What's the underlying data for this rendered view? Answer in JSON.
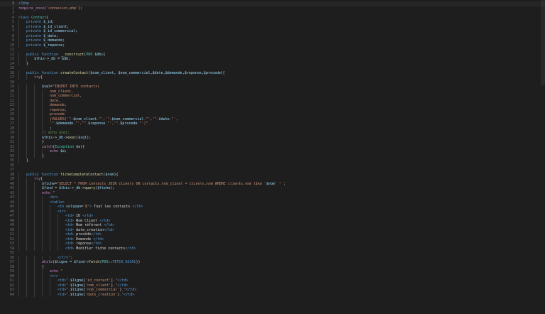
{
  "editor": {
    "active_line": 1,
    "lines": [
      {
        "n": "1",
        "i": 0,
        "t": [
          [
            "t-pre",
            "<?php"
          ]
        ]
      },
      {
        "n": "2",
        "i": 0,
        "t": [
          [
            "t-ctl",
            "require_once"
          ],
          [
            "t-pun",
            "("
          ],
          [
            "t-str",
            "'connexion.php'"
          ],
          [
            "t-pun",
            ");"
          ]
        ]
      },
      {
        "n": "3",
        "i": 0,
        "t": []
      },
      {
        "n": "4",
        "i": 0,
        "t": [
          [
            "t-kw",
            "class "
          ],
          [
            "t-cls",
            "Contact"
          ],
          [
            "t-pun",
            "{"
          ]
        ]
      },
      {
        "n": "5",
        "i": 1,
        "t": [
          [
            "t-kw",
            "private "
          ],
          [
            "t-var",
            "$_id"
          ],
          [
            "t-pun",
            ";"
          ]
        ]
      },
      {
        "n": "6",
        "i": 1,
        "t": [
          [
            "t-kw",
            "private "
          ],
          [
            "t-var",
            "$_id_client"
          ],
          [
            "t-pun",
            ";"
          ]
        ]
      },
      {
        "n": "7",
        "i": 1,
        "t": [
          [
            "t-kw",
            "private "
          ],
          [
            "t-var",
            "$_id_commercial"
          ],
          [
            "t-pun",
            ";"
          ]
        ]
      },
      {
        "n": "8",
        "i": 1,
        "t": [
          [
            "t-kw",
            "private "
          ],
          [
            "t-var",
            "$_date"
          ],
          [
            "t-pun",
            ";"
          ]
        ]
      },
      {
        "n": "9",
        "i": 1,
        "t": [
          [
            "t-kw",
            "private "
          ],
          [
            "t-var",
            "$_demande"
          ],
          [
            "t-pun",
            ";"
          ]
        ]
      },
      {
        "n": "10",
        "i": 1,
        "t": [
          [
            "t-kw",
            "private "
          ],
          [
            "t-var",
            "$_reponse"
          ],
          [
            "t-pun",
            ";"
          ]
        ]
      },
      {
        "n": "11",
        "i": 0,
        "t": []
      },
      {
        "n": "12",
        "i": 1,
        "t": [
          [
            "t-kw",
            "public function "
          ],
          [
            "t-fn",
            "__construct"
          ],
          [
            "t-pun",
            "("
          ],
          [
            "t-cls",
            "PDO "
          ],
          [
            "t-var",
            "$db"
          ],
          [
            "t-pun",
            "){"
          ]
        ]
      },
      {
        "n": "13",
        "i": 2,
        "t": [
          [
            "t-var",
            "$this"
          ],
          [
            "t-pun",
            "->"
          ],
          [
            "t-var",
            "_db"
          ],
          [
            "t-pun",
            " = "
          ],
          [
            "t-var",
            "$db"
          ],
          [
            "t-pun",
            ";"
          ]
        ]
      },
      {
        "n": "14",
        "i": 1,
        "t": [
          [
            "t-pun",
            "}"
          ]
        ]
      },
      {
        "n": "15",
        "i": 0,
        "t": []
      },
      {
        "n": "16",
        "i": 1,
        "t": [
          [
            "t-kw",
            "public function "
          ],
          [
            "t-fn",
            "createContact"
          ],
          [
            "t-pun",
            "("
          ],
          [
            "t-var",
            "$nom_client"
          ],
          [
            "t-pun",
            ", "
          ],
          [
            "t-var",
            "$nom_commercial"
          ],
          [
            "t-pun",
            ","
          ],
          [
            "t-var",
            "$date"
          ],
          [
            "t-pun",
            ","
          ],
          [
            "t-var",
            "$demande"
          ],
          [
            "t-pun",
            ","
          ],
          [
            "t-var",
            "$reponse"
          ],
          [
            "t-pun",
            ","
          ],
          [
            "t-var",
            "$procede"
          ],
          [
            "t-pun",
            "){"
          ]
        ]
      },
      {
        "n": "17",
        "i": 2,
        "t": [
          [
            "t-ctl",
            "try"
          ],
          [
            "t-pun",
            "{"
          ]
        ]
      },
      {
        "n": "18",
        "i": 0,
        "t": []
      },
      {
        "n": "19",
        "i": 3,
        "t": [
          [
            "t-var",
            "$sql"
          ],
          [
            "t-pun",
            "="
          ],
          [
            "t-str",
            "\"INSERT INTO contacts("
          ]
        ]
      },
      {
        "n": "20",
        "i": 4,
        "t": [
          [
            "t-str",
            "nom_client,"
          ]
        ]
      },
      {
        "n": "21",
        "i": 4,
        "t": [
          [
            "t-str",
            "nom_commercial,"
          ]
        ]
      },
      {
        "n": "22",
        "i": 4,
        "t": [
          [
            "t-str",
            "date,"
          ]
        ]
      },
      {
        "n": "23",
        "i": 4,
        "t": [
          [
            "t-str",
            "demande,"
          ]
        ]
      },
      {
        "n": "24",
        "i": 4,
        "t": [
          [
            "t-str",
            "reponse,"
          ]
        ]
      },
      {
        "n": "25",
        "i": 4,
        "t": [
          [
            "t-str",
            "procede"
          ]
        ]
      },
      {
        "n": "26",
        "i": 4,
        "t": [
          [
            "t-str",
            ")VALUES('\"."
          ],
          [
            "t-var",
            "$nom_client"
          ],
          [
            "t-str",
            ".\"','\"."
          ],
          [
            "t-var",
            "$nom_commercial"
          ],
          [
            "t-str",
            ".\"','\"."
          ],
          [
            "t-var",
            "$date"
          ],
          [
            "t-str",
            ".\"',"
          ]
        ]
      },
      {
        "n": "27",
        "i": 4,
        "t": [
          [
            "t-str",
            "'\"."
          ],
          [
            "t-var",
            "$demande"
          ],
          [
            "t-str",
            ".\"','\"."
          ],
          [
            "t-var",
            "$reponse"
          ],
          [
            "t-str",
            ".\"','\"."
          ],
          [
            "t-var",
            "$procede"
          ],
          [
            "t-str",
            ".\"')\""
          ]
        ]
      },
      {
        "n": "28",
        "i": 4,
        "t": [
          [
            "t-pun",
            ";"
          ]
        ]
      },
      {
        "n": "29",
        "i": 3,
        "t": [
          [
            "t-cmt",
            "// echo $sql;"
          ]
        ]
      },
      {
        "n": "30",
        "i": 3,
        "t": [
          [
            "t-var",
            "$this"
          ],
          [
            "t-pun",
            "->"
          ],
          [
            "t-var",
            "_db"
          ],
          [
            "t-pun",
            "->"
          ],
          [
            "t-fn",
            "exec"
          ],
          [
            "t-pun",
            "("
          ],
          [
            "t-var",
            "$sql"
          ],
          [
            "t-pun",
            ");"
          ]
        ]
      },
      {
        "n": "31",
        "i": 3,
        "t": [
          [
            "t-pun",
            "}"
          ]
        ]
      },
      {
        "n": "32",
        "i": 3,
        "t": [
          [
            "t-ctl",
            "catch"
          ],
          [
            "t-pun",
            "("
          ],
          [
            "t-cls",
            "Exception "
          ],
          [
            "t-var",
            "$e"
          ],
          [
            "t-pun",
            "){"
          ]
        ]
      },
      {
        "n": "33",
        "i": 4,
        "t": [
          [
            "t-ctl",
            "echo "
          ],
          [
            "t-var",
            "$e"
          ],
          [
            "t-pun",
            ";"
          ]
        ]
      },
      {
        "n": "34",
        "i": 3,
        "t": [
          [
            "t-pun",
            "}"
          ]
        ]
      },
      {
        "n": "35",
        "i": 1,
        "t": [
          [
            "t-pun",
            "}"
          ]
        ]
      },
      {
        "n": "36",
        "i": 0,
        "t": []
      },
      {
        "n": "37",
        "i": 0,
        "t": []
      },
      {
        "n": "38",
        "i": 1,
        "t": [
          [
            "t-kw",
            "public function "
          ],
          [
            "t-fn",
            "ficheCompleteContact"
          ],
          [
            "t-pun",
            "("
          ],
          [
            "t-var",
            "$nom"
          ],
          [
            "t-pun",
            "){"
          ]
        ]
      },
      {
        "n": "39",
        "i": 2,
        "t": [
          [
            "t-ctl",
            "try"
          ],
          [
            "t-pun",
            "{"
          ]
        ]
      },
      {
        "n": "40",
        "i": 3,
        "t": [
          [
            "t-var",
            "$fiche"
          ],
          [
            "t-pun",
            "="
          ],
          [
            "t-str",
            "\"SELECT * FROM contacts JOIN clients ON contacts.nom_client = clients.nom WHERE clients.nom like '"
          ],
          [
            "t-var",
            "$nom"
          ],
          [
            "t-str",
            "' \""
          ],
          [
            "t-pun",
            " ;"
          ]
        ]
      },
      {
        "n": "41",
        "i": 3,
        "t": [
          [
            "t-var",
            "$find"
          ],
          [
            "t-pun",
            " = "
          ],
          [
            "t-var",
            "$this"
          ],
          [
            "t-pun",
            "->"
          ],
          [
            "t-var",
            "_db"
          ],
          [
            "t-pun",
            "->"
          ],
          [
            "t-fn",
            "query"
          ],
          [
            "t-pun",
            "("
          ],
          [
            "t-var",
            "$fiche"
          ],
          [
            "t-pun",
            ");"
          ]
        ]
      },
      {
        "n": "42",
        "i": 3,
        "t": [
          [
            "t-ctl",
            "echo "
          ],
          [
            "t-str",
            "\""
          ]
        ]
      },
      {
        "n": "43",
        "i": 4,
        "t": [
          [
            "t-tag",
            "<br>"
          ]
        ]
      },
      {
        "n": "44",
        "i": 4,
        "t": [
          [
            "t-tag",
            "<table>"
          ]
        ]
      },
      {
        "n": "45",
        "i": 5,
        "t": [
          [
            "t-tag",
            "<th "
          ],
          [
            "t-attr",
            "colspan"
          ],
          [
            "t-pun",
            "="
          ],
          [
            "t-str",
            "'8'"
          ],
          [
            "t-tag",
            "> "
          ],
          [
            "t-txt",
            "Tout les contacts "
          ],
          [
            "t-tag",
            "</th>"
          ]
        ]
      },
      {
        "n": "46",
        "i": 5,
        "t": [
          [
            "t-tag",
            "<tr>"
          ]
        ]
      },
      {
        "n": "47",
        "i": 6,
        "t": [
          [
            "t-tag",
            "<td> "
          ],
          [
            "t-txt",
            "ID "
          ],
          [
            "t-tag",
            "</td>"
          ]
        ]
      },
      {
        "n": "48",
        "i": 6,
        "t": [
          [
            "t-tag",
            "<td> "
          ],
          [
            "t-txt",
            "Nom Client "
          ],
          [
            "t-tag",
            "</td>"
          ]
        ]
      },
      {
        "n": "49",
        "i": 6,
        "t": [
          [
            "t-tag",
            "<td> "
          ],
          [
            "t-txt",
            "Nom référent "
          ],
          [
            "t-tag",
            "</td>"
          ]
        ]
      },
      {
        "n": "50",
        "i": 6,
        "t": [
          [
            "t-tag",
            "<td> "
          ],
          [
            "t-txt",
            "date_creation"
          ],
          [
            "t-tag",
            "</td>"
          ]
        ]
      },
      {
        "n": "51",
        "i": 6,
        "t": [
          [
            "t-tag",
            "<td> "
          ],
          [
            "t-txt",
            "procédé"
          ],
          [
            "t-tag",
            "</td>"
          ]
        ]
      },
      {
        "n": "52",
        "i": 6,
        "t": [
          [
            "t-tag",
            "<td> "
          ],
          [
            "t-txt",
            "Demande "
          ],
          [
            "t-tag",
            "</td>"
          ]
        ]
      },
      {
        "n": "53",
        "i": 6,
        "t": [
          [
            "t-tag",
            "<td> "
          ],
          [
            "t-txt",
            "réponse"
          ],
          [
            "t-tag",
            "</td>"
          ]
        ]
      },
      {
        "n": "54",
        "i": 6,
        "t": [
          [
            "t-tag",
            "<td> "
          ],
          [
            "t-txt",
            "Modifier fiche contacts"
          ],
          [
            "t-tag",
            "</td>"
          ]
        ]
      },
      {
        "n": "55",
        "i": 0,
        "t": []
      },
      {
        "n": "56",
        "i": 5,
        "t": [
          [
            "t-tag",
            "</tr>"
          ],
          [
            "t-str",
            "\";"
          ]
        ]
      },
      {
        "n": "57",
        "i": 3,
        "t": [
          [
            "t-ctl",
            "while"
          ],
          [
            "t-pun",
            "("
          ],
          [
            "t-var",
            "$ligne"
          ],
          [
            "t-pun",
            " = "
          ],
          [
            "t-var",
            "$find"
          ],
          [
            "t-pun",
            "->"
          ],
          [
            "t-fn",
            "fetch"
          ],
          [
            "t-pun",
            "("
          ],
          [
            "t-cls",
            "PDO"
          ],
          [
            "t-pun",
            "::"
          ],
          [
            "t-kw",
            "FETCH_ASSOC"
          ],
          [
            "t-pun",
            "))"
          ]
        ]
      },
      {
        "n": "58",
        "i": 3,
        "t": [
          [
            "t-pun",
            "{"
          ]
        ]
      },
      {
        "n": "59",
        "i": 4,
        "t": [
          [
            "t-ctl",
            "echo "
          ],
          [
            "t-str",
            "\""
          ]
        ]
      },
      {
        "n": "60",
        "i": 4,
        "t": [
          [
            "t-tag",
            "<tr>"
          ]
        ]
      },
      {
        "n": "61",
        "i": 5,
        "t": [
          [
            "t-tag",
            "<td>"
          ],
          [
            "t-str",
            "\"."
          ],
          [
            "t-var",
            "$ligne"
          ],
          [
            "t-pun",
            "["
          ],
          [
            "t-str",
            "'id_contact'"
          ],
          [
            "t-pun",
            "]"
          ],
          [
            "t-str",
            ".\""
          ],
          [
            "t-tag",
            "</td>"
          ]
        ]
      },
      {
        "n": "62",
        "i": 5,
        "t": [
          [
            "t-tag",
            "<td>"
          ],
          [
            "t-str",
            "\"."
          ],
          [
            "t-var",
            "$ligne"
          ],
          [
            "t-pun",
            "["
          ],
          [
            "t-str",
            "'nom_client'"
          ],
          [
            "t-pun",
            "]"
          ],
          [
            "t-str",
            ".\""
          ],
          [
            "t-tag",
            "</td>"
          ]
        ]
      },
      {
        "n": "63",
        "i": 5,
        "t": [
          [
            "t-tag",
            "<td>"
          ],
          [
            "t-str",
            "\"."
          ],
          [
            "t-var",
            "$ligne"
          ],
          [
            "t-pun",
            "["
          ],
          [
            "t-str",
            "'nom_commercial'"
          ],
          [
            "t-pun",
            "]"
          ],
          [
            "t-str",
            ".\""
          ],
          [
            "t-tag",
            "</td>"
          ]
        ]
      },
      {
        "n": "64",
        "i": 5,
        "t": [
          [
            "t-tag",
            "<td>"
          ],
          [
            "t-str",
            "\"."
          ],
          [
            "t-var",
            "$ligne"
          ],
          [
            "t-pun",
            "["
          ],
          [
            "t-str",
            "'date_creation'"
          ],
          [
            "t-pun",
            "]"
          ],
          [
            "t-str",
            ".\""
          ],
          [
            "t-tag",
            "</td>"
          ]
        ]
      }
    ]
  }
}
